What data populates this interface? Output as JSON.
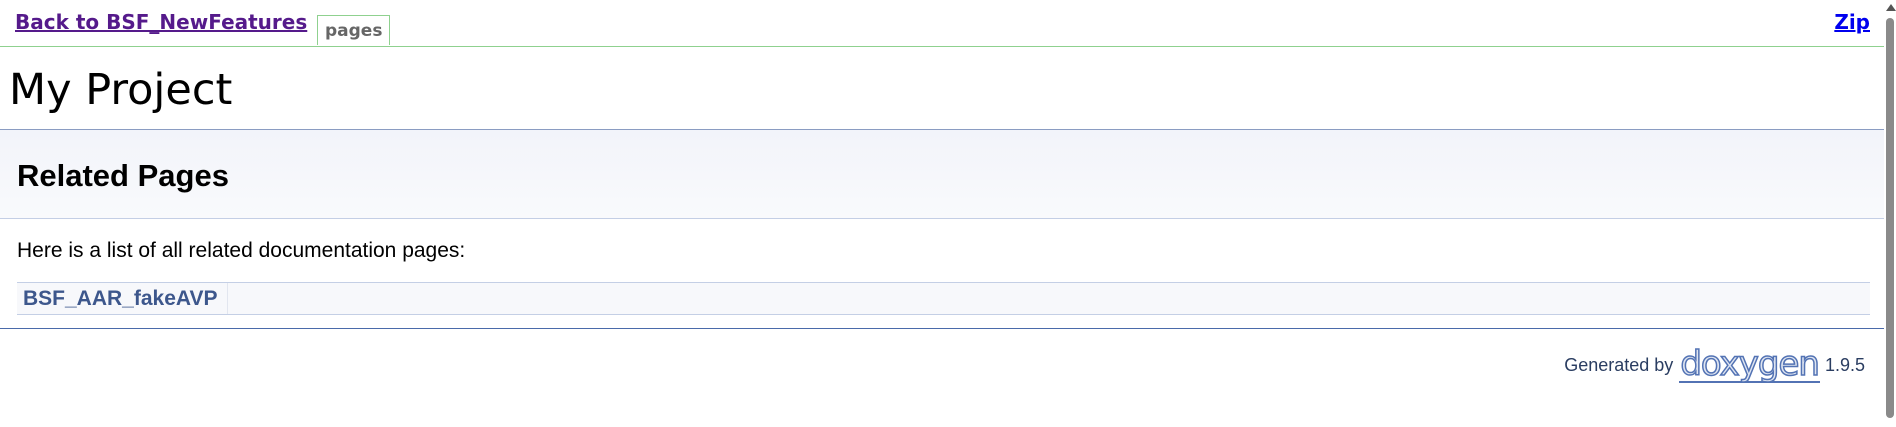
{
  "topbar": {
    "back_label": "Back to BSF_NewFeatures",
    "pages_tab": "pages",
    "zip_label": "Zip"
  },
  "project": {
    "title": "My Project"
  },
  "header": {
    "title": "Related Pages"
  },
  "content": {
    "intro": "Here is a list of all related documentation pages:",
    "pages": [
      {
        "label": "BSF_AAR_fakeAVP"
      }
    ]
  },
  "footer": {
    "generated_by": "Generated by",
    "logo_text": "doxygen",
    "version": "1.9.5"
  },
  "colors": {
    "link_visited": "#551a8b",
    "link": "#0000ee",
    "page_link": "#3d578c",
    "tab_border": "#8fd18f",
    "rule": "#4a6aaa"
  }
}
